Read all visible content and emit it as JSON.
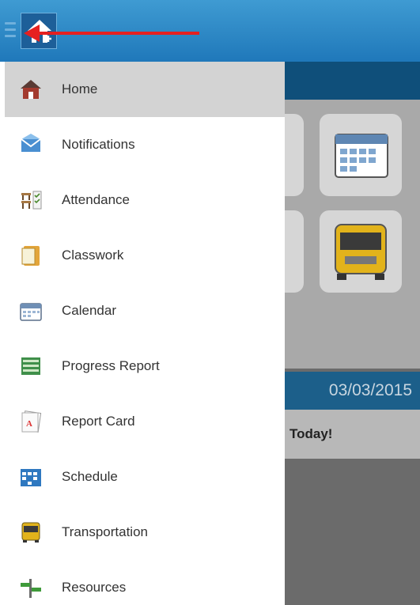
{
  "date_label": "03/03/2015",
  "today_label": "Today!",
  "colors": {
    "app_bar": "#2b88c6",
    "drawer_bg": "#ffffff",
    "active_item_bg": "#d3d3d3",
    "annotation_arrow": "#e52020"
  },
  "menu": {
    "items": [
      {
        "label": "Home",
        "icon": "home-icon",
        "active": true
      },
      {
        "label": "Notifications",
        "icon": "envelope-icon",
        "active": false
      },
      {
        "label": "Attendance",
        "icon": "attendance-desks-icon",
        "active": false
      },
      {
        "label": "Classwork",
        "icon": "notepad-icon",
        "active": false
      },
      {
        "label": "Calendar",
        "icon": "calendar-icon",
        "active": false
      },
      {
        "label": "Progress Report",
        "icon": "progress-report-icon",
        "active": false
      },
      {
        "label": "Report Card",
        "icon": "report-card-icon",
        "active": false
      },
      {
        "label": "Schedule",
        "icon": "schedule-grid-icon",
        "active": false
      },
      {
        "label": "Transportation",
        "icon": "school-bus-icon",
        "active": false
      },
      {
        "label": "Resources",
        "icon": "signpost-icon",
        "active": false
      }
    ]
  }
}
